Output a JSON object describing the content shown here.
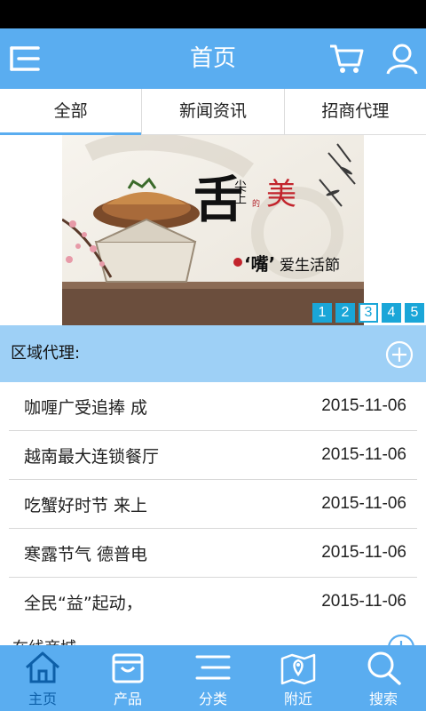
{
  "header": {
    "title": "首页",
    "menu_icon": "menu-icon",
    "cart_icon": "cart-icon",
    "user_icon": "user-icon"
  },
  "tabs": [
    {
      "label": "全部",
      "active": true
    },
    {
      "label": "新闻资讯"
    },
    {
      "label": "招商代理"
    }
  ],
  "banner": {
    "headline_main": "舌",
    "headline_small": "尖上",
    "headline_tiny": "的",
    "headline_mei": "美",
    "slogan_prefix": "‘嘴’",
    "slogan_rest": "爱生活節",
    "pages": [
      "1",
      "2",
      "3",
      "4",
      "5"
    ],
    "active_page": "3"
  },
  "section": {
    "label": "区域代理:",
    "icon": "plus-circle-icon"
  },
  "news": [
    {
      "title": "咖喱广受追捧 成",
      "date": "2015-11-06"
    },
    {
      "title": "越南最大连锁餐厅",
      "date": "2015-11-06"
    },
    {
      "title": "吃蟹好时节 来上",
      "date": "2015-11-06"
    },
    {
      "title": "寒露节气 德普电",
      "date": "2015-11-06"
    },
    {
      "title": "全民“益”起动，",
      "date": "2015-11-06"
    }
  ],
  "section2": {
    "label": "在线商城"
  },
  "bottom_nav": [
    {
      "label": "主页",
      "icon": "home-icon",
      "active": true
    },
    {
      "label": "产品",
      "icon": "bag-icon"
    },
    {
      "label": "分类",
      "icon": "list-icon"
    },
    {
      "label": "附近",
      "icon": "map-icon"
    },
    {
      "label": "搜索",
      "icon": "search-icon"
    }
  ],
  "colors": {
    "accent": "#5aadf0",
    "section_bg": "#9ed0f6",
    "pager": "#1aa6d8",
    "nav_active": "#0d5fa8"
  }
}
